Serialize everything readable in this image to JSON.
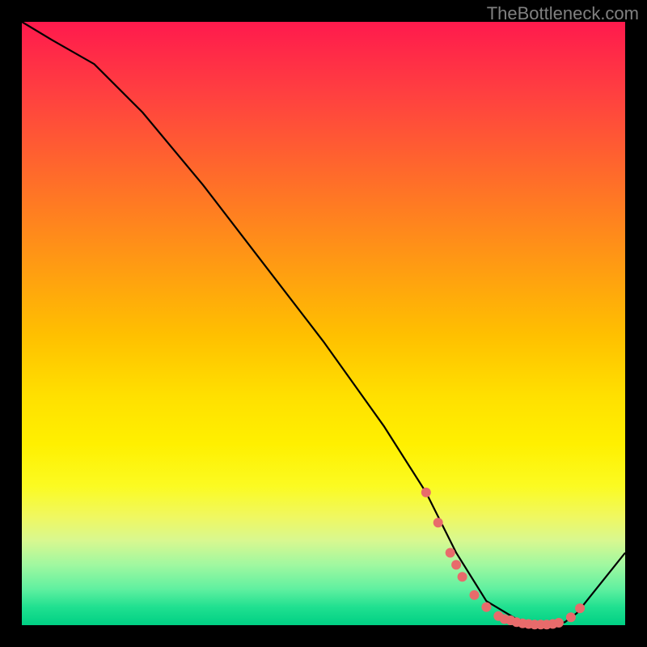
{
  "watermark": "TheBottleneck.com",
  "chart_data": {
    "type": "line",
    "title": "",
    "xlabel": "",
    "ylabel": "",
    "xlim": [
      0,
      100
    ],
    "ylim": [
      0,
      100
    ],
    "series": [
      {
        "name": "bottleneck-curve",
        "x": [
          0,
          5,
          12,
          20,
          30,
          40,
          50,
          60,
          67,
          72,
          77,
          82,
          87,
          90,
          92,
          100
        ],
        "values": [
          100,
          97,
          93,
          85,
          73,
          60,
          47,
          33,
          22,
          12,
          4,
          1,
          0,
          0.5,
          2,
          12
        ]
      }
    ],
    "markers": {
      "name": "highlight-dots",
      "color": "#e86b6b",
      "points": [
        {
          "x": 67,
          "y": 22
        },
        {
          "x": 69,
          "y": 17
        },
        {
          "x": 71,
          "y": 12
        },
        {
          "x": 72,
          "y": 10
        },
        {
          "x": 73,
          "y": 8
        },
        {
          "x": 75,
          "y": 5
        },
        {
          "x": 77,
          "y": 3
        },
        {
          "x": 79,
          "y": 1.5
        },
        {
          "x": 80,
          "y": 1
        },
        {
          "x": 81,
          "y": 0.8
        },
        {
          "x": 82,
          "y": 0.5
        },
        {
          "x": 83,
          "y": 0.3
        },
        {
          "x": 84,
          "y": 0.2
        },
        {
          "x": 85,
          "y": 0.1
        },
        {
          "x": 86,
          "y": 0.1
        },
        {
          "x": 87,
          "y": 0.1
        },
        {
          "x": 88,
          "y": 0.2
        },
        {
          "x": 89,
          "y": 0.4
        },
        {
          "x": 91,
          "y": 1.3
        },
        {
          "x": 92.5,
          "y": 2.8
        }
      ]
    }
  }
}
